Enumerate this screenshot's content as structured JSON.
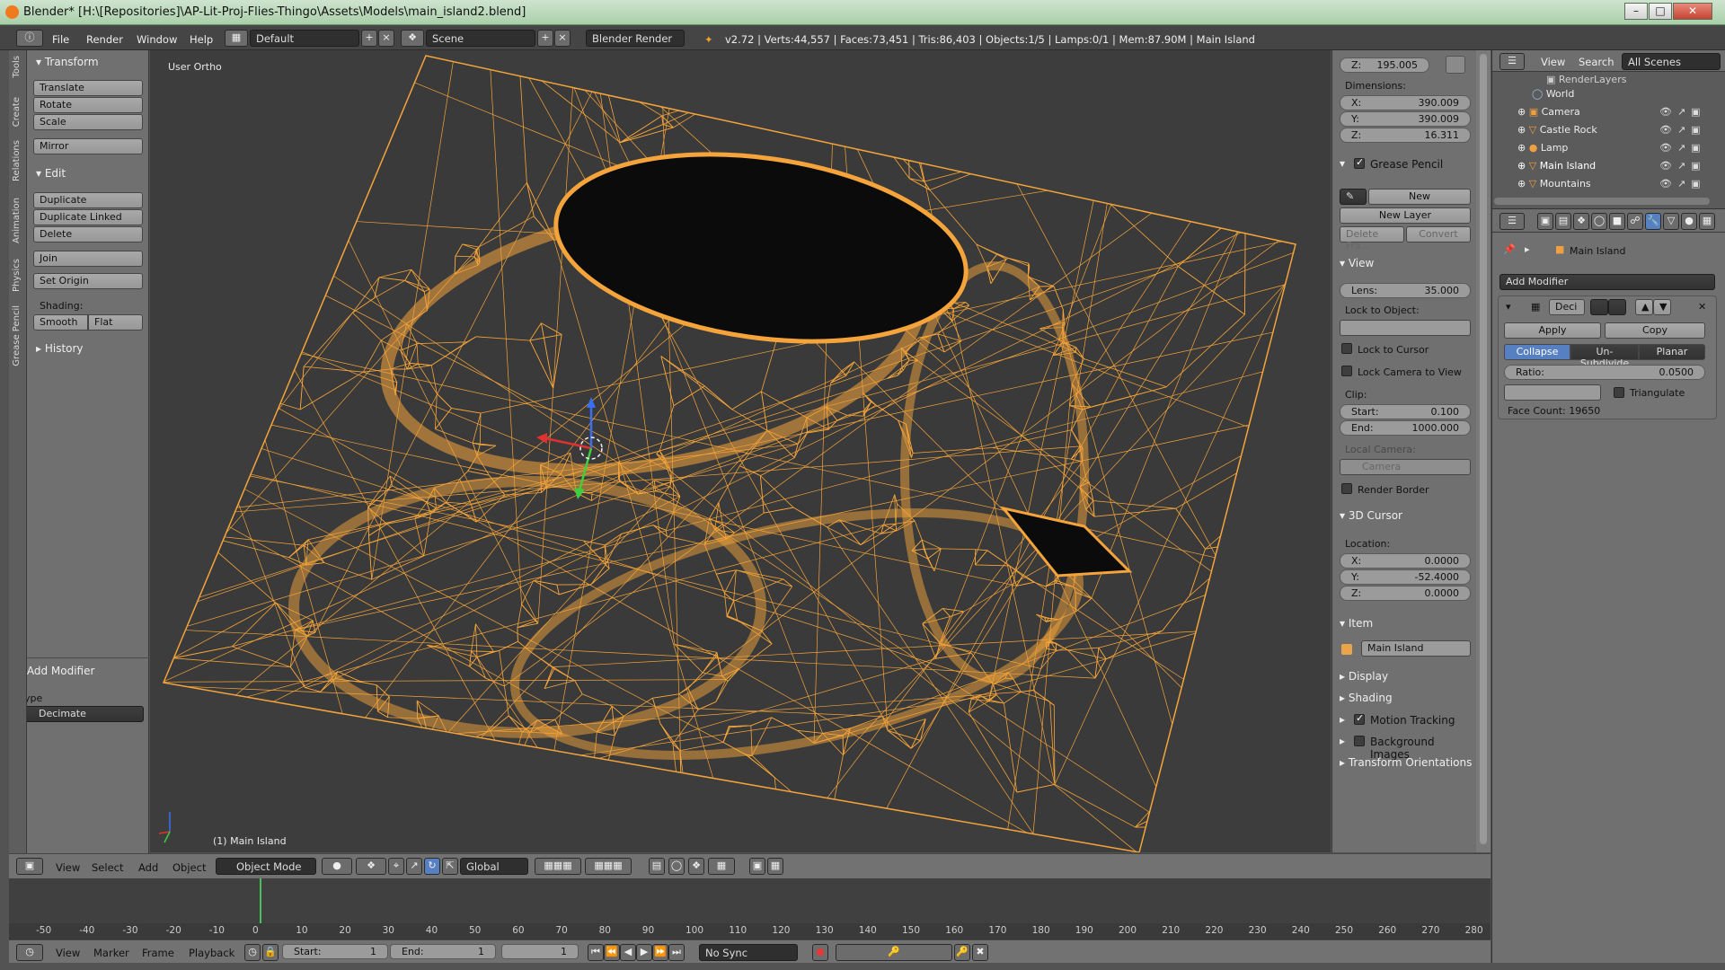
{
  "window": {
    "title": "Blender* [H:\\[Repositories]\\AP-Lit-Proj-Flies-Thingo\\Assets\\Models\\main_island2.blend]",
    "min": "–",
    "max": "□",
    "close": "✕"
  },
  "infobar": {
    "menus": [
      "File",
      "Render",
      "Window",
      "Help"
    ],
    "screen_layout": "Default",
    "scene": "Scene",
    "engine": "Blender Render",
    "stats": "v2.72 | Verts:44,557 | Faces:73,451 | Tris:86,403 | Objects:1/5 | Lamps:0/1 | Mem:87.90M | Main Island"
  },
  "toolshelf": {
    "tabs": [
      "Tools",
      "Create",
      "Relations",
      "Animation",
      "Physics",
      "Grease Pencil"
    ],
    "transform_title": "Transform",
    "transform_buttons": [
      "Translate",
      "Rotate",
      "Scale",
      "Mirror"
    ],
    "edit_title": "Edit",
    "edit_buttons": [
      "Duplicate",
      "Duplicate Linked",
      "Delete",
      "Join"
    ],
    "set_origin": "Set Origin",
    "shading_label": "Shading:",
    "smooth": "Smooth",
    "flat": "Flat",
    "history": "History",
    "op_title": "Add Modifier",
    "type_label": "Type",
    "type_value": "Decimate"
  },
  "viewport": {
    "view_name": "User Ortho",
    "object_label": "(1) Main Island"
  },
  "viewport_header": {
    "menus": [
      "View",
      "Select",
      "Add",
      "Object"
    ],
    "mode": "Object Mode",
    "orientation": "Global"
  },
  "timeline": {
    "ticks": [
      -50,
      -40,
      -30,
      -20,
      -10,
      0,
      10,
      20,
      30,
      40,
      50,
      60,
      70,
      80,
      90,
      100,
      110,
      120,
      130,
      140,
      150,
      160,
      170,
      180,
      190,
      200,
      210,
      220,
      230,
      240,
      250,
      260,
      270,
      280
    ],
    "current_frame_value": 0,
    "menus": [
      "View",
      "Marker",
      "Frame",
      "Playback"
    ],
    "start_label": "Start:",
    "start_value": "1",
    "end_label": "End:",
    "end_value": "1",
    "frame_value": "1",
    "sync": "No Sync"
  },
  "npanel": {
    "loc_z_label": "Z:",
    "loc_z": "195.005",
    "dimensions_label": "Dimensions:",
    "dim": [
      {
        "k": "X:",
        "v": "390.009"
      },
      {
        "k": "Y:",
        "v": "390.009"
      },
      {
        "k": "Z:",
        "v": "16.311"
      }
    ],
    "grease_title": "Grease Pencil",
    "gp_new": "New",
    "gp_new_layer": "New Layer",
    "gp_delete": "Delete Fra...",
    "gp_convert": "Convert",
    "view_title": "View",
    "lens_label": "Lens:",
    "lens": "35.000",
    "lock_object_label": "Lock to Object:",
    "lock_cursor": "Lock to Cursor",
    "lock_camera": "Lock Camera to View",
    "clip_label": "Clip:",
    "clip_start_label": "Start:",
    "clip_start": "0.100",
    "clip_end_label": "End:",
    "clip_end": "1000.000",
    "local_camera_label": "Local Camera:",
    "local_camera": "Camera",
    "render_border": "Render Border",
    "cursor_title": "3D Cursor",
    "location_label": "Location:",
    "cursor": [
      {
        "k": "X:",
        "v": "0.0000"
      },
      {
        "k": "Y:",
        "v": "-52.4000"
      },
      {
        "k": "Z:",
        "v": "0.0000"
      }
    ],
    "item_title": "Item",
    "item_name": "Main Island",
    "display": "Display",
    "shading": "Shading",
    "motion_tracking": "Motion Tracking",
    "background_images": "Background Images",
    "transform_orientations": "Transform Orientations"
  },
  "outliner": {
    "view": "View",
    "search": "Search",
    "scenes": "All Scenes",
    "items": [
      "RenderLayers",
      "World",
      "Camera",
      "Castle Rock",
      "Lamp",
      "Main Island",
      "Mountains"
    ]
  },
  "properties": {
    "object_name": "Main Island",
    "add_modifier": "Add Modifier",
    "mod_name": "Deci",
    "apply": "Apply",
    "copy": "Copy",
    "modes": [
      "Collapse",
      "Un-Subdivide",
      "Planar"
    ],
    "ratio_label": "Ratio:",
    "ratio": "0.0500",
    "triangulate": "Triangulate",
    "face_count": "Face Count: 19650"
  },
  "colors": {
    "wire": "#f4a43a",
    "accent": "#5680c2",
    "selected": "#f4a43a"
  }
}
